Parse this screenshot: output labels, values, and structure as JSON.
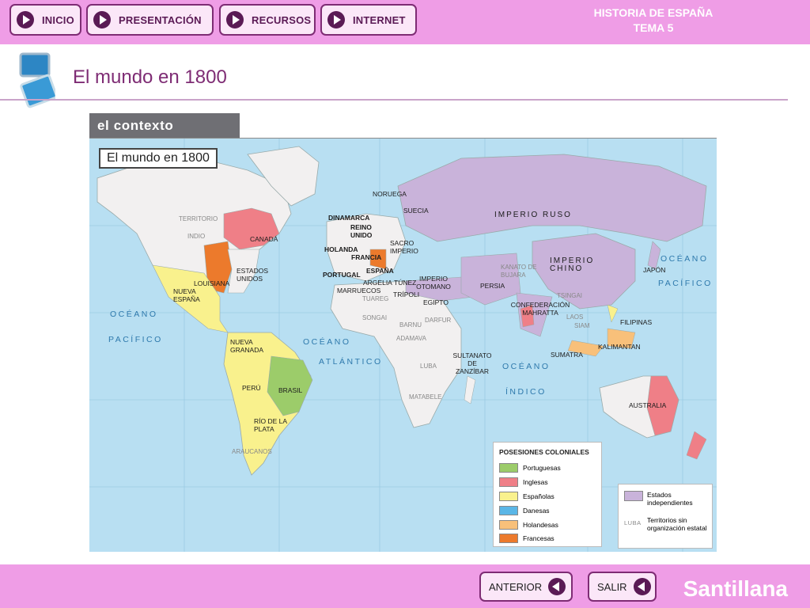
{
  "nav": {
    "inicio": "INICIO",
    "presentacion": "PRESENTACIÓN",
    "recursos": "RECURSOS",
    "internet": "INTERNET"
  },
  "course": {
    "line1": "HISTORIA DE ESPAÑA",
    "line2": "TEMA 5"
  },
  "page_title": "El mundo en 1800",
  "section_tab": "el contexto",
  "map": {
    "title": "El mundo en 1800",
    "labels": {
      "territorio": "TERRITORIO",
      "indio": "INDIO",
      "canada": "CANADÁ",
      "estados_unidos": "ESTADOS UNIDOS",
      "louisiana": "LOUISIANA",
      "nueva_espana": "NUEVA ESPAÑA",
      "nueva_granada": "NUEVA GRANADA",
      "peru": "PERÚ",
      "brasil": "BRASIL",
      "rio_de_la_plata": "RÍO DE LA PLATA",
      "araucanos": "ARAUCANOS",
      "noruega": "NORUEGA",
      "suecia": "SUECIA",
      "dinamarca": "DINAMARCA",
      "reino_unido": "REINO UNIDO",
      "holanda": "HOLANDA",
      "francia": "FRANCIA",
      "sacro_imperio": "SACRO IMPERIO",
      "portugal": "PORTUGAL",
      "espana": "ESPAÑA",
      "marruecos": "MARRUECOS",
      "argelia": "ARGELIA",
      "tunez": "TÚNEZ",
      "tripoli": "TRÍPOLI",
      "tuareg": "TUAREG",
      "imperio_otomano": "IMPERIO OTOMANO",
      "egipto": "EGIPTO",
      "songai": "SONGAI",
      "barnu": "BARNU",
      "darfur": "DARFUR",
      "adamava": "ADAMAVA",
      "luba": "LUBA",
      "matabele": "MATABELE",
      "sultanato": "SULTANATO DE ZANZÍBAR",
      "imperio_ruso": "IMPERIO RUSO",
      "persia": "PERSIA",
      "kanato": "KANATO DE BUJARA",
      "imperio_chino": "IMPERIO CHINO",
      "japon": "JAPÓN",
      "confederacion": "CONFEDERACIÓN MAHRATTA",
      "tsingai": "TSINGAI",
      "laos": "LAOS",
      "siam": "SIAM",
      "filipinas": "FILIPINAS",
      "kalimantan": "KALIMANTAN",
      "sumatra": "SUMATRA",
      "australia": "AUSTRALIA",
      "oceano_pacifico_w1": "OCÉANO",
      "oceano_pacifico_w2": "PACÍFICO",
      "oceano_atlantico1": "OCÉANO",
      "oceano_atlantico2": "ATLÁNTICO",
      "oceano_indico1": "OCÉANO",
      "oceano_indico2": "ÍNDICO",
      "oceano_pacifico_e1": "OCÉANO",
      "oceano_pacifico_e2": "PACÍFICO"
    },
    "legend": {
      "title": "POSESIONES COLONIALES",
      "items": [
        {
          "label": "Portuguesas",
          "color": "#9ccc6a"
        },
        {
          "label": "Inglesas",
          "color": "#ef7f87"
        },
        {
          "label": "Españolas",
          "color": "#f9f18d"
        },
        {
          "label": "Danesas",
          "color": "#5ab6e6"
        },
        {
          "label": "Holandesas",
          "color": "#f8c07a"
        },
        {
          "label": "Francesas",
          "color": "#ec7a2c"
        }
      ],
      "independientes": {
        "label": "Estados independientes",
        "color": "#c9b3da"
      },
      "sin_organizacion": {
        "marker": "LUBA",
        "label": "Territorios sin organización estatal"
      }
    }
  },
  "footer": {
    "anterior": "ANTERIOR",
    "salir": "SALIR",
    "brand": "Santillana"
  }
}
